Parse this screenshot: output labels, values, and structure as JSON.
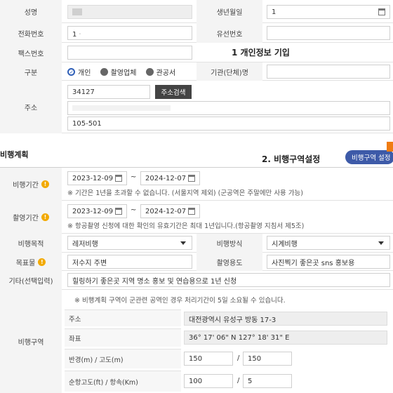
{
  "personal": {
    "name_label": "성명",
    "birth_label": "생년월일",
    "birth_value": "1",
    "phone_label": "전화번호",
    "phone_value": "1ᆞ",
    "landline_label": "유선번호",
    "fax_label": "팩스번호",
    "callout": "1 개인정보 기입",
    "type_label": "구분",
    "type_options": [
      "개인",
      "촬영업체",
      "관공서"
    ],
    "org_label": "기관(단체)명",
    "addr_label": "주소",
    "zip_value": "34127",
    "addr_search_button": "주소검색",
    "addr_detail_value": "105-501"
  },
  "plan": {
    "section_title": "비행계획",
    "callout": "2. 비행구역설정",
    "zone_button": "비행구역 설정",
    "flight_period_label": "비행기간",
    "flight_start": "2023-12-09",
    "flight_end": "2024-12-07",
    "tilde": "~",
    "flight_period_note": "※ 기간은 1년을 초과할 수 없습니다. (서울지역 제외) (군공역은 주말에만 사용 가능)",
    "shoot_period_label": "촬영기간",
    "shoot_start": "2023-12-09",
    "shoot_end": "2024-12-07",
    "shoot_period_note": "※ 항공촬영 신청에 대한 확인의 유효기간은 최대 1년입니다.(항공촬영 지침서 제5조)",
    "purpose_label": "비행목적",
    "purpose_value": "레저비행",
    "method_label": "비행방식",
    "method_value": "시계비행",
    "target_label": "목표물",
    "target_value": "저수지 주변",
    "use_label": "촬영용도",
    "use_value": "사진찍기 좋은곳 sns 홍보용",
    "etc_label": "기타(선택입력)",
    "etc_value": "힐링하기 좋은곳 지역 명소 홍보 및 연습용으로 1년 신청",
    "zone_label": "비행구역",
    "zone_note": "※ 비행계획 구역이 군관련 공역인 경우 처리기간이 5일 소요될 수 있습니다.",
    "zone_addr_label": "주소",
    "zone_addr_value": "대전광역시 유성구 방동 17-3",
    "coord_label": "좌표",
    "coord_value": "36° 17' 06\" N 127° 18' 31\" E",
    "radius_label": "반경(m) / 고도(m)",
    "radius_value": "150",
    "altitude_value": "150",
    "slash": "/",
    "cruise_label": "순항고도(ft) / 항속(Km)",
    "cruise_value": "100",
    "speed_value": "5"
  },
  "colors": {
    "accent_blue": "#3d5aa8",
    "warn": "#f2a900",
    "radio_checked": "#2f5fb7",
    "radio_gray": "#666666"
  }
}
